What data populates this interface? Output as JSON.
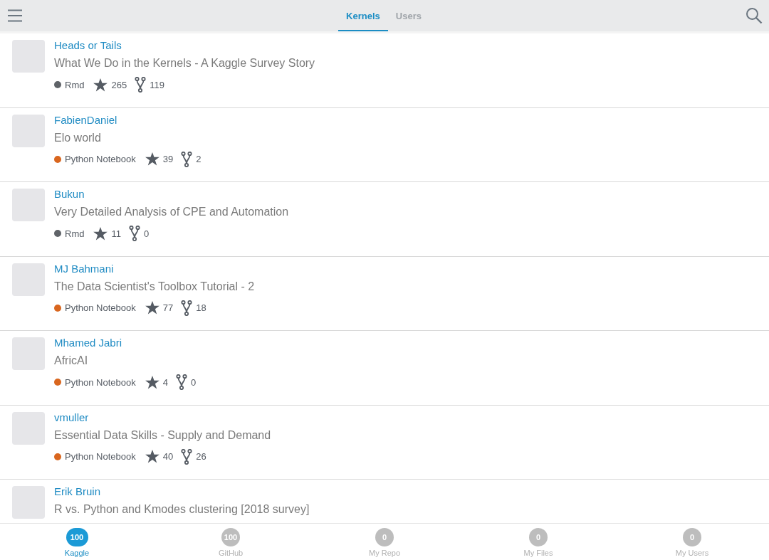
{
  "top_tabs": [
    {
      "label": "Kernels",
      "selected": true
    },
    {
      "label": "Users",
      "selected": false
    }
  ],
  "kernels": [
    {
      "author": "Heads or Tails",
      "title": "What We Do in the Kernels - A Kaggle Survey Story",
      "meta": {
        "language": "Rmd",
        "color": "#5f6368",
        "stars": "265",
        "forks": "119"
      }
    },
    {
      "author": "FabienDaniel",
      "title": "Elo world",
      "meta": {
        "language": "Python Notebook",
        "color": "#d9661e",
        "stars": "39",
        "forks": "2"
      }
    },
    {
      "author": "Bukun",
      "title": "Very Detailed Analysis of CPE and Automation",
      "meta": {
        "language": "Rmd",
        "color": "#5f6368",
        "stars": "11",
        "forks": "0"
      }
    },
    {
      "author": "MJ Bahmani",
      "title": "The Data Scientist's Toolbox Tutorial - 2",
      "meta": {
        "language": "Python Notebook",
        "color": "#d9661e",
        "stars": "77",
        "forks": "18"
      }
    },
    {
      "author": "Mhamed Jabri",
      "title": "AfricAI",
      "meta": {
        "language": "Python Notebook",
        "color": "#d9661e",
        "stars": "4",
        "forks": "0"
      }
    },
    {
      "author": "vmuller",
      "title": "Essential Data Skills - Supply and Demand",
      "meta": {
        "language": "Python Notebook",
        "color": "#d9661e",
        "stars": "40",
        "forks": "26"
      }
    },
    {
      "author": "Erik Bruin",
      "title": "R vs. Python and Kmodes clustering [2018 survey]"
    }
  ],
  "bottom_tabs": [
    {
      "count": "100",
      "label": "Kaggle",
      "selected": true
    },
    {
      "count": "100",
      "label": "GitHub",
      "selected": false
    },
    {
      "count": "0",
      "label": "My Repo",
      "selected": false
    },
    {
      "count": "0",
      "label": "My Files",
      "selected": false
    },
    {
      "count": "0",
      "label": "My Users",
      "selected": false
    }
  ]
}
